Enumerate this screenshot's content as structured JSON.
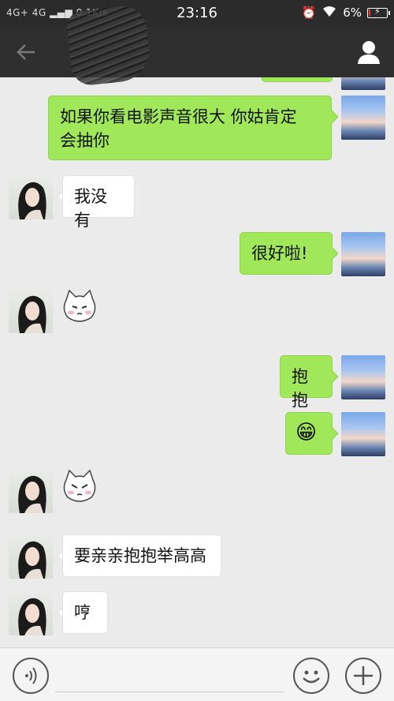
{
  "status_bar": {
    "network": "4G+ 4G",
    "speed": "0.1K/s",
    "time": "23:16",
    "battery": "6%"
  },
  "title_bar": {
    "back_icon": "arrow-left-icon",
    "profile_icon": "person-icon"
  },
  "messages": [
    {
      "from": "me",
      "type": "text",
      "text": "如果你看电影声音很大 你姑肯定会抽你",
      "line1": "如果你看电影声音很大 你姑肯定",
      "line2": "会抽你"
    },
    {
      "from": "her",
      "type": "text",
      "text": "我没有"
    },
    {
      "from": "me",
      "type": "text",
      "text": "很好啦!"
    },
    {
      "from": "her",
      "type": "sticker",
      "sticker": "blushing-cat-sticker"
    },
    {
      "from": "me",
      "type": "text",
      "text": "抱抱"
    },
    {
      "from": "me",
      "type": "emoji",
      "emoji": "😁"
    },
    {
      "from": "her",
      "type": "sticker",
      "sticker": "grumpy-cat-sticker"
    },
    {
      "from": "her",
      "type": "text",
      "text": "要亲亲抱抱举高高"
    },
    {
      "from": "her",
      "type": "text",
      "text": "哼"
    }
  ],
  "bottom_bar": {
    "voice_icon": "voice-icon",
    "emoji_icon": "smiley-icon",
    "more_icon": "plus-icon"
  },
  "colors": {
    "bubble_me": "#a0e75a",
    "bubble_her": "#ffffff",
    "chat_bg": "#ebebeb",
    "title_bar": "#2f2f2f"
  }
}
